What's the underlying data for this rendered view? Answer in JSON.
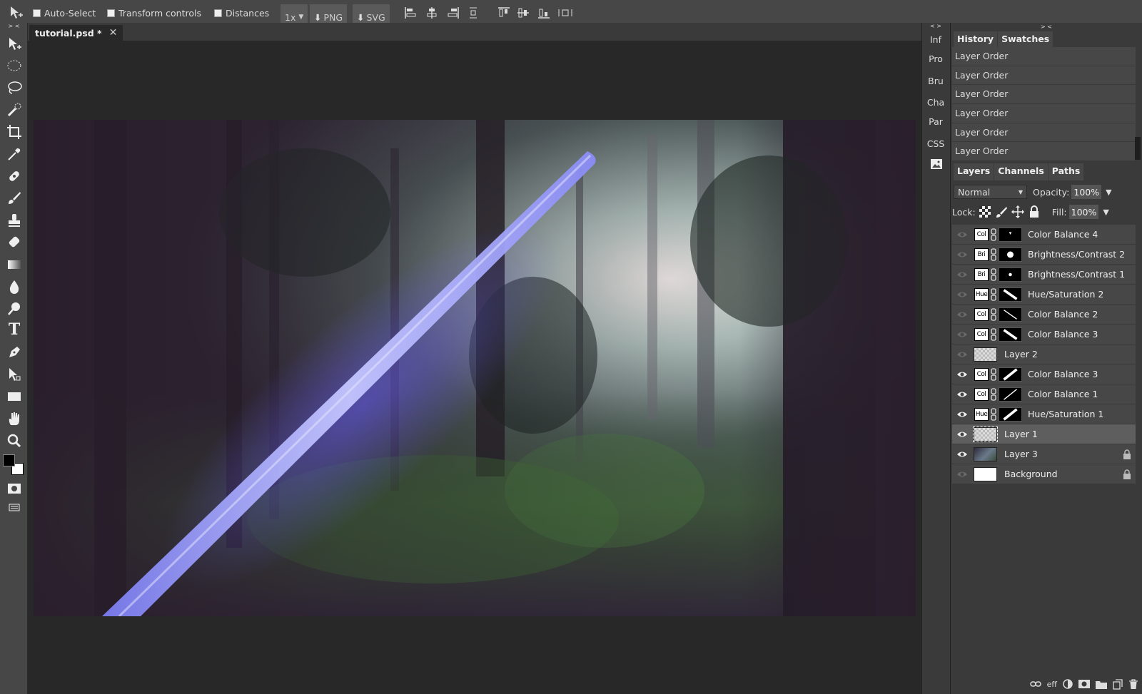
{
  "toolbar": {
    "auto_select_label": "Auto-Select",
    "transform_controls_label": "Transform controls",
    "distances_label": "Distances",
    "scale_value": "1x",
    "png_label": "PNG",
    "svg_label": "SVG"
  },
  "left_toolbar": {
    "collapse_label": "> <",
    "tools": [
      "move-tool",
      "marquee-tool",
      "lasso-tool",
      "quick-select-tool",
      "crop-tool",
      "eyedropper-tool",
      "healing-tool",
      "brush-tool",
      "clone-stamp-tool",
      "eraser-tool",
      "gradient-tool",
      "blur-tool",
      "dodge-tool",
      "type-tool",
      "pen-tool",
      "path-select-tool",
      "rectangle-tool",
      "hand-tool",
      "zoom-tool"
    ],
    "type_tool_glyph": "T"
  },
  "document": {
    "tab_title": "tutorial.psd *",
    "close_glyph": "✕"
  },
  "mini_panels": {
    "collapse_label": "< >",
    "items": [
      "Inf",
      "Pro",
      "Bru",
      "Cha",
      "Par",
      "CSS"
    ]
  },
  "right_panel": {
    "collapse_label": "> <",
    "history_tabs": [
      "History",
      "Swatches"
    ],
    "history_items": [
      "Layer Order",
      "Layer Order",
      "Layer Order",
      "Layer Order",
      "Layer Order",
      "Layer Order"
    ],
    "layers_tabs": [
      "Layers",
      "Channels",
      "Paths"
    ],
    "blend_mode": "Normal",
    "opacity_label": "Opacity:",
    "opacity_value": "100%",
    "lock_label": "Lock:",
    "fill_label": "Fill:",
    "fill_value": "100%",
    "layers": [
      {
        "name": "Color Balance 4",
        "badge": "Col",
        "visible": false,
        "adjustment": true,
        "locked": false,
        "selected": false
      },
      {
        "name": "Brightness/Contrast 2",
        "badge": "Bri",
        "visible": false,
        "adjustment": true,
        "locked": false,
        "selected": false
      },
      {
        "name": "Brightness/Contrast 1",
        "badge": "Bri",
        "visible": false,
        "adjustment": true,
        "locked": false,
        "selected": false
      },
      {
        "name": "Hue/Saturation 2",
        "badge": "Hue",
        "visible": false,
        "adjustment": true,
        "locked": false,
        "selected": false
      },
      {
        "name": "Color Balance 2",
        "badge": "Col",
        "visible": false,
        "adjustment": true,
        "locked": false,
        "selected": false
      },
      {
        "name": "Color Balance 3",
        "badge": "Col",
        "visible": false,
        "adjustment": true,
        "locked": false,
        "selected": false
      },
      {
        "name": "Layer 2",
        "badge": "",
        "visible": false,
        "adjustment": false,
        "locked": false,
        "selected": false
      },
      {
        "name": "Color Balance 3",
        "badge": "Col",
        "visible": true,
        "adjustment": true,
        "locked": false,
        "selected": false
      },
      {
        "name": "Color Balance 1",
        "badge": "Col",
        "visible": true,
        "adjustment": true,
        "locked": false,
        "selected": false
      },
      {
        "name": "Hue/Saturation 1",
        "badge": "Hue",
        "visible": true,
        "adjustment": true,
        "locked": false,
        "selected": false
      },
      {
        "name": "Layer 1",
        "badge": "",
        "visible": true,
        "adjustment": false,
        "locked": false,
        "selected": true
      },
      {
        "name": "Layer 3",
        "badge": "",
        "visible": true,
        "adjustment": false,
        "locked": true,
        "selected": false
      },
      {
        "name": "Background",
        "badge": "",
        "visible": false,
        "adjustment": false,
        "locked": true,
        "selected": false
      }
    ],
    "bottom_eff_label": "eff"
  },
  "colors": {
    "ui_dark": "#282828",
    "ui_mid": "#3a3a3a",
    "ui_light": "#474747",
    "saber_blue": "#8a8cf5"
  }
}
